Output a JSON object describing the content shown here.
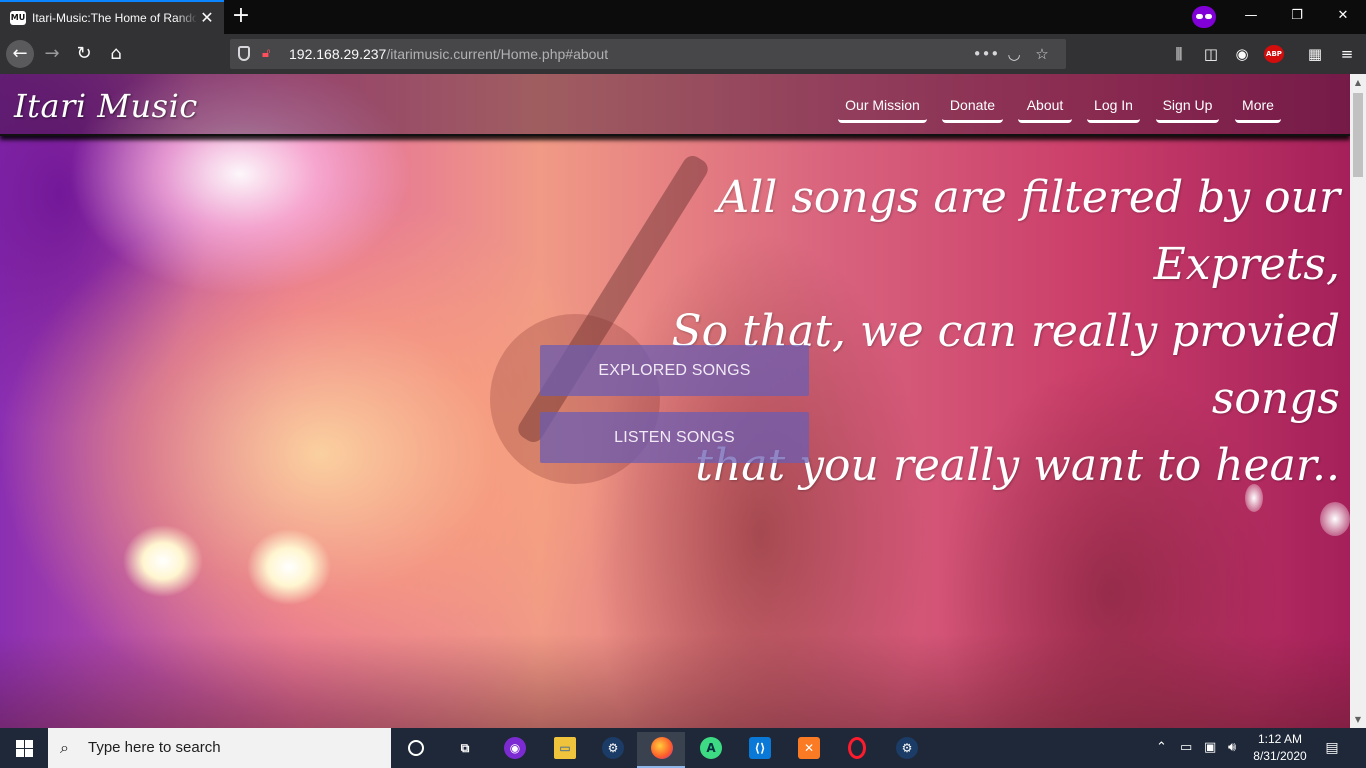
{
  "browser": {
    "tab_title": "Itari-Music:The Home of Rando",
    "url_host": "192.168.29.237",
    "url_path": "/itarimusic.current/Home.php#about",
    "url_actions": {
      "more": "•••",
      "pocket": "◡",
      "bookmark": "☆"
    },
    "new_tab": "+",
    "close": "✕",
    "window_controls": {
      "minimize": "—",
      "maximize": "❐",
      "close": "✕"
    },
    "toolbar_icons": [
      "library-icon",
      "reader-icon",
      "account-icon",
      "adblock-icon",
      "extensions-icon",
      "menu-icon"
    ],
    "abp_label": "ABP",
    "accent_color": "#0a84ff"
  },
  "site": {
    "logo": "Itari Music",
    "nav": [
      "Our Mission",
      "Donate",
      "About",
      "Log In",
      "Sign Up",
      "More"
    ],
    "hero_lines": [
      "All songs are filtered by our Exprets,",
      "So that, we can really provied songs",
      "that you really want to hear.."
    ],
    "buttons": {
      "explore": "EXPLORED SONGS",
      "listen": "LISTEN SONGS"
    },
    "button_color": "#6c5eb2"
  },
  "taskbar": {
    "search_placeholder": "Type here to search",
    "apps": [
      "cortana-icon",
      "task-view-icon",
      "podcast-app-icon",
      "file-explorer-icon",
      "steam-icon",
      "firefox-icon",
      "android-studio-icon",
      "vscode-icon",
      "xampp-icon",
      "opera-icon",
      "steam-icon"
    ],
    "time": "1:12 AM",
    "date": "8/31/2020"
  }
}
